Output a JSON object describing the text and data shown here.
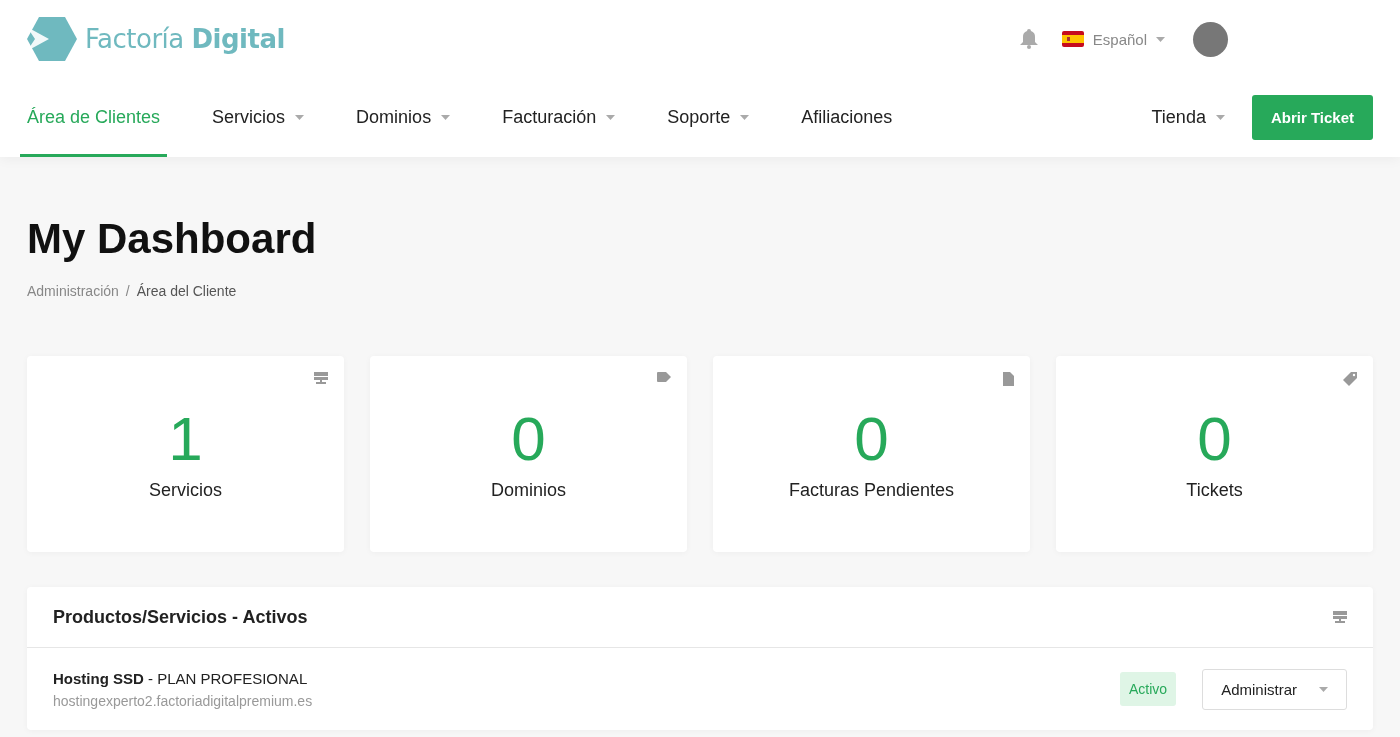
{
  "brand": {
    "name": "Factoría **Digital**"
  },
  "top_bar": {
    "language": "Español"
  },
  "nav": {
    "items": [
      {
        "label": "Área de Clientes",
        "selected": true,
        "dropdown": false
      },
      {
        "label": "Servicios",
        "selected": false,
        "dropdown": true
      },
      {
        "label": "Dominios",
        "selected": false,
        "dropdown": true
      },
      {
        "label": "Facturación",
        "selected": false,
        "dropdown": true
      },
      {
        "label": "Soporte",
        "selected": false,
        "dropdown": true
      },
      {
        "label": "Afiliaciones",
        "selected": false,
        "dropdown": false
      }
    ],
    "store": {
      "label": "Tienda",
      "dropdown": true
    },
    "cta": "Abrir Ticket"
  },
  "page": {
    "title": "My Dashboard",
    "breadcrumb": [
      "Administración",
      "Área del Cliente"
    ],
    "breadcrumb_separator": "/"
  },
  "stats": [
    {
      "value": "1",
      "label": "Servicios"
    },
    {
      "value": "0",
      "label": "Dominios"
    },
    {
      "value": "0",
      "label": "Facturas Pendientes"
    },
    {
      "value": "0",
      "label": "Tickets"
    }
  ],
  "products_panel": {
    "title": "Productos/Servicios - Activos",
    "items": [
      {
        "name": "**Hosting SSD** - PLAN PROFESIONAL",
        "domain": "hostingexperto2.factoriadigitalpremium.es",
        "status": "Activo",
        "action": "Administrar"
      }
    ]
  }
}
